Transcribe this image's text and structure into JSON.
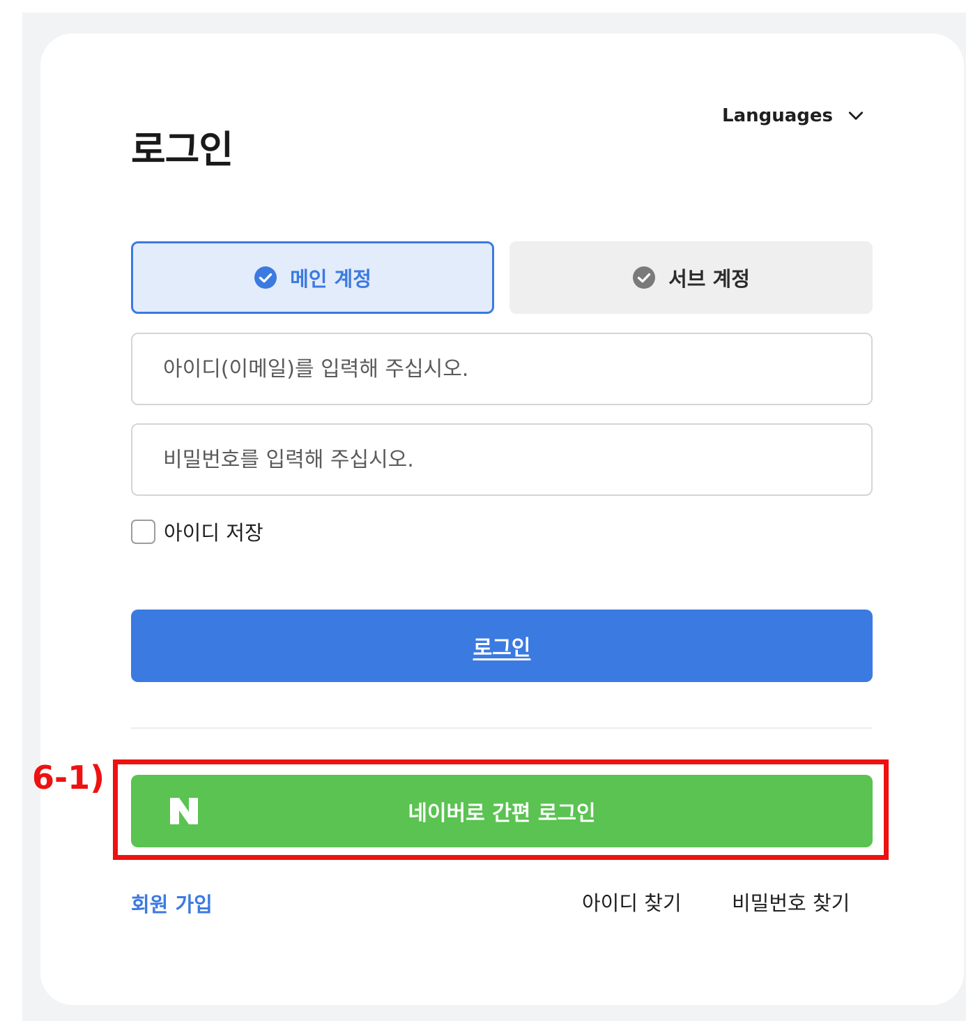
{
  "header": {
    "title": "로그인",
    "languages_label": "Languages",
    "languages_icon": "chevron-down-icon"
  },
  "account_tabs": {
    "main": {
      "label": "메인 계정",
      "selected": true,
      "icon": "check-circle-icon"
    },
    "sub": {
      "label": "서브 계정",
      "selected": false,
      "icon": "check-circle-icon"
    }
  },
  "form": {
    "id_placeholder": "아이디(이메일)를 입력해 주십시오.",
    "id_value": "",
    "password_placeholder": "비밀번호를 입력해 주십시오.",
    "password_value": "",
    "remember_label": "아이디 저장",
    "remember_checked": false,
    "login_label": "로그인"
  },
  "social": {
    "naver_logo": "N",
    "naver_label": "네이버로 간편 로그인"
  },
  "annotation": {
    "label": "6-1)"
  },
  "footer": {
    "signup_label": "회원 가입",
    "find_id_label": "아이디 찾기",
    "find_password_label": "비밀번호 찾기"
  },
  "colors": {
    "accent": "#3b7ae1",
    "accent_light": "#e3ecfb",
    "naver_green": "#5ac351",
    "annotation_red": "#ee1111",
    "tab_inactive": "#efefef"
  }
}
